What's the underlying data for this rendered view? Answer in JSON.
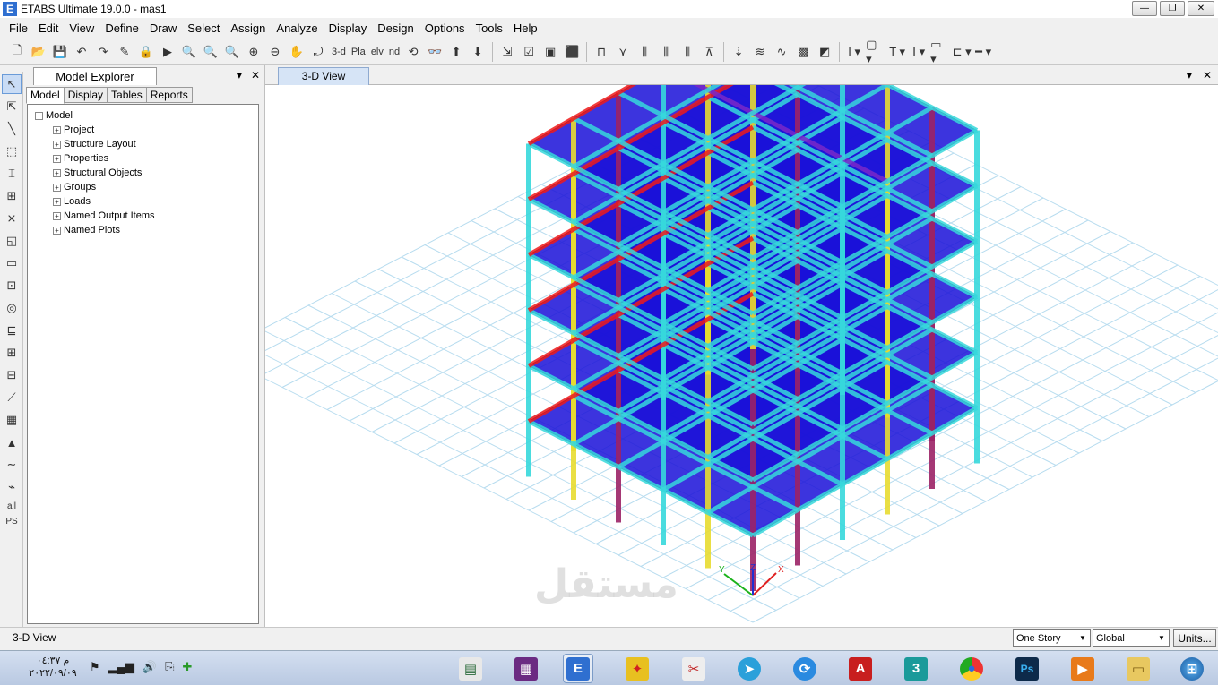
{
  "window": {
    "title": "ETABS Ultimate 19.0.0 - mas1",
    "app_icon_letter": "E"
  },
  "menu": [
    "File",
    "Edit",
    "View",
    "Define",
    "Draw",
    "Select",
    "Assign",
    "Analyze",
    "Display",
    "Design",
    "Options",
    "Tools",
    "Help"
  ],
  "toolbar": {
    "view_3d": "3-d",
    "view_plan": "Pla",
    "view_elev": "elv",
    "view_nd": "nd"
  },
  "left_toolbar": {
    "all_label": "all",
    "ps_label": "PS"
  },
  "explorer": {
    "title": "Model Explorer",
    "tabs": [
      "Model",
      "Display",
      "Tables",
      "Reports"
    ],
    "root": "Model",
    "items": [
      "Project",
      "Structure Layout",
      "Properties",
      "Structural Objects",
      "Groups",
      "Loads",
      "Named Output Items",
      "Named Plots"
    ]
  },
  "view": {
    "tab_label": "3-D View"
  },
  "status": {
    "text": "3-D View",
    "story_combo": "One Story",
    "coord_combo": "Global",
    "units_button": "Units..."
  },
  "axes": {
    "x": "X",
    "y": "Y",
    "z": "Z"
  },
  "watermark": "مستقل",
  "taskbar": {
    "time": "م ٠٤:٣٧",
    "date": "٢٠٢٢/٠٩/٠٩",
    "etabs_letter": "E",
    "ps_letter": "Ps",
    "max_letter": "3",
    "autocad_letter": "A"
  },
  "colors": {
    "slab": "#1a10d8",
    "beam": "#36d8dc",
    "column_magenta": "#9b2266",
    "column_yellow": "#e8dc30",
    "beam_red": "#ee1a1a",
    "beam_purple": "#7a28c8",
    "grid": "#b7dcef",
    "accent": "#d6e4f6"
  }
}
